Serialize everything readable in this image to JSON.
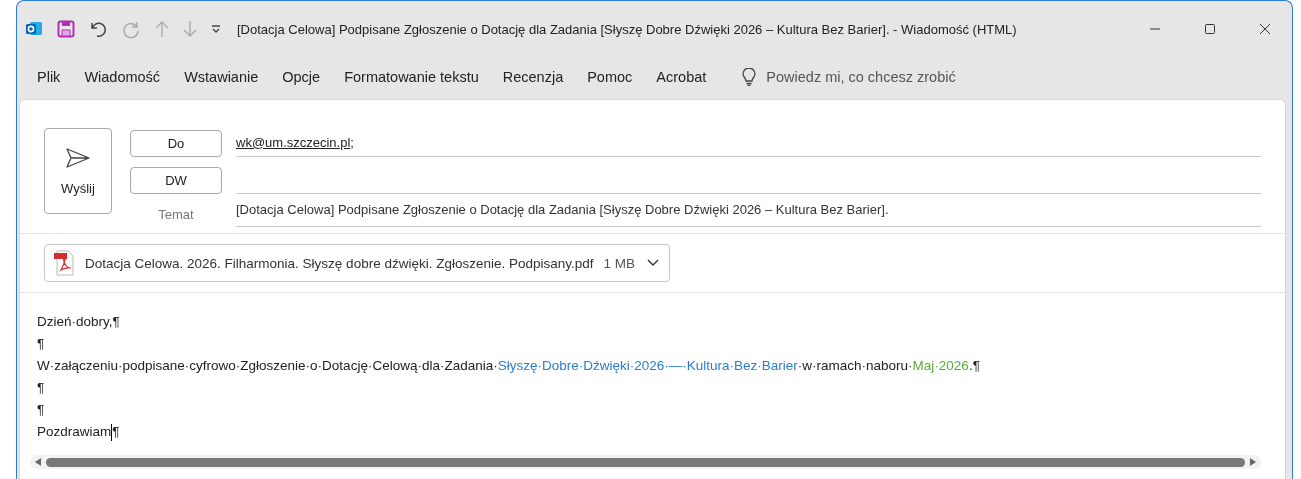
{
  "window": {
    "title": "[Dotacja Celowa] Podpisane Zgłoszenie o Dotację dla Zadania [Słyszę Dobre Dźwięki 2026 – Kultura Bez Barier].  -  Wiadomość (HTML)"
  },
  "menu": [
    "Plik",
    "Wiadomość",
    "Wstawianie",
    "Opcje",
    "Formatowanie tekstu",
    "Recenzja",
    "Pomoc",
    "Acrobat"
  ],
  "tell_me": {
    "placeholder": "Powiedz mi, co chcesz zrobić"
  },
  "compose": {
    "send_label": "Wyślij",
    "to_label": "Do",
    "to_value": "wk@um.szczecin.pl",
    "to_separator": ";",
    "cc_label": "DW",
    "subject_label": "Temat",
    "subject_value": "[Dotacja Celowa] Podpisane Zgłoszenie o Dotację dla Zadania [Słyszę Dobre Dźwięki 2026 – Kultura Bez Barier]."
  },
  "attachment": {
    "name": "Dotacja Celowa. 2026. Filharmonia. Słyszę dobre dźwięki. Zgłoszenie. Podpisany.pdf",
    "size": "1 MB"
  },
  "body": [
    {
      "runs": [
        {
          "text": "Dzień·dobry,¶",
          "color": "#222222"
        }
      ]
    },
    {
      "runs": [
        {
          "text": "¶",
          "color": "#222222"
        }
      ]
    },
    {
      "runs": [
        {
          "text": "W·załączeniu·podpisane·cyfrowo·Zgłoszenie·o·Dotację·Celową·dla·Zadania·",
          "color": "#222222"
        },
        {
          "text": "Słyszę·Dobre·Dźwięki·2026·—·Kultura·Bez·Barier",
          "color": "#2b7cd3"
        },
        {
          "text": "·w·ramach·naboru·",
          "color": "#222222"
        },
        {
          "text": "Maj·2026",
          "color": "#5aac3a"
        },
        {
          "text": ".¶",
          "color": "#222222"
        }
      ]
    },
    {
      "runs": [
        {
          "text": "¶",
          "color": "#222222"
        }
      ]
    },
    {
      "runs": [
        {
          "text": "¶",
          "color": "#222222"
        }
      ]
    },
    {
      "runs": [
        {
          "text": "Pozdrawiam",
          "color": "#222222",
          "cursor_after": true
        },
        {
          "text": "¶",
          "color": "#222222"
        }
      ]
    }
  ]
}
